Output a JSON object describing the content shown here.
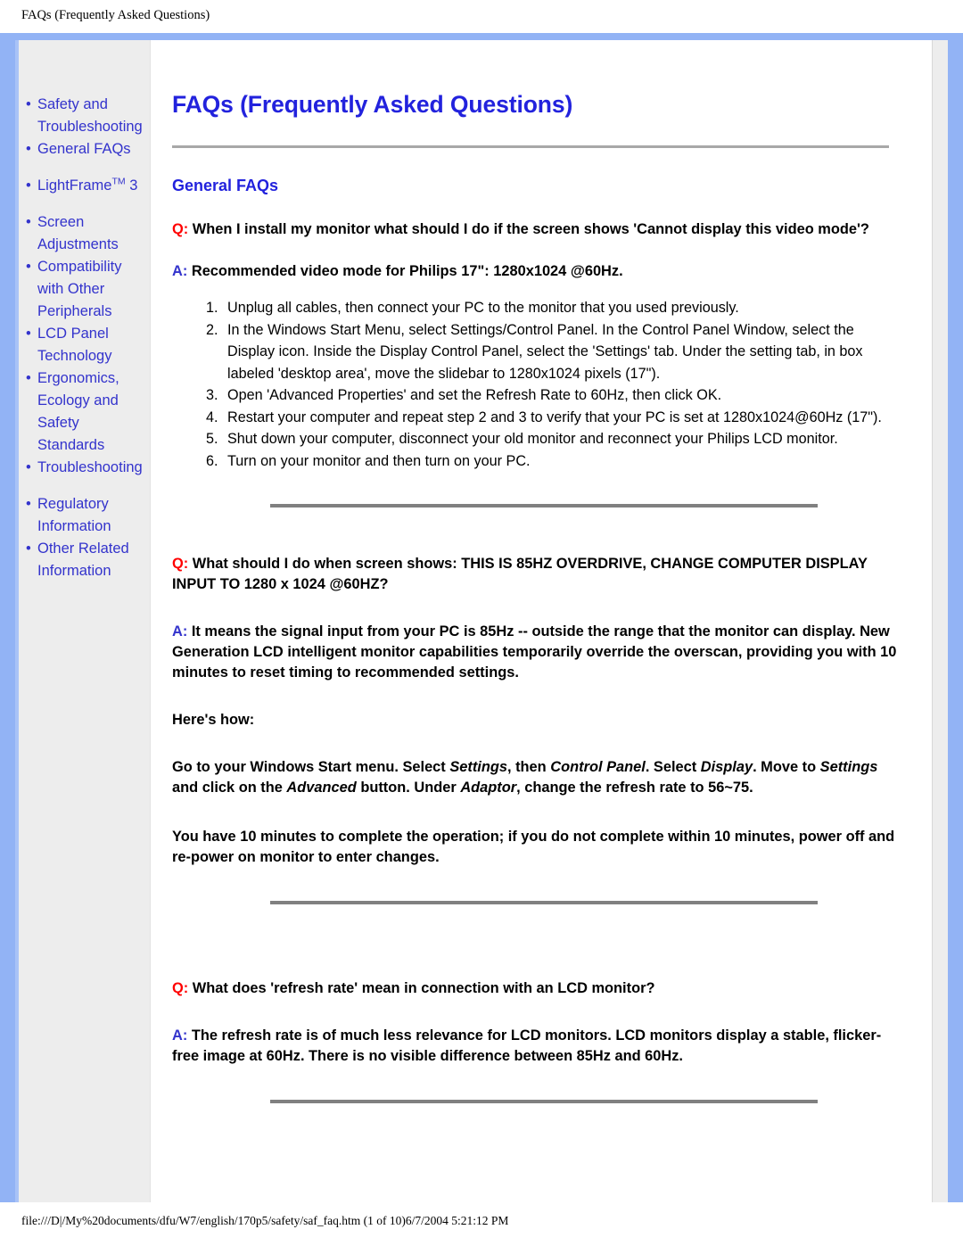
{
  "print_header": {
    "title": "FAQs (Frequently Asked Questions)"
  },
  "sidebar": {
    "items": [
      {
        "label": "Safety and Troubleshooting"
      },
      {
        "label": "General FAQs"
      },
      {
        "label_prefix": "LightFrame",
        "superscript": "TM",
        "label_suffix": " 3"
      },
      {
        "label": "Screen Adjustments"
      },
      {
        "label": "Compatibility with Other Peripherals"
      },
      {
        "label": "LCD Panel Technology"
      },
      {
        "label": "Ergonomics, Ecology and Safety Standards"
      },
      {
        "label": "Troubleshooting"
      },
      {
        "label": "Regulatory Information"
      },
      {
        "label": "Other Related Information"
      }
    ]
  },
  "main": {
    "page_title": "FAQs (Frequently Asked Questions)",
    "section_title": "General FAQs",
    "q_marker": "Q:",
    "a_marker": "A:",
    "qa": [
      {
        "question": "When I install my monitor what should I do if the screen shows 'Cannot display this video mode'?",
        "answer": "Recommended video mode for Philips 17\": 1280x1024 @60Hz.",
        "steps": [
          "Unplug all cables, then connect your PC to the monitor that you used previously.",
          "In the Windows Start Menu, select Settings/Control Panel. In the Control Panel Window, select the Display icon. Inside the Display Control Panel, select the 'Settings' tab. Under the setting tab, in box labeled 'desktop area', move the slidebar to 1280x1024 pixels (17\").",
          "Open 'Advanced Properties' and set the Refresh Rate to 60Hz, then click OK.",
          "Restart your computer and repeat step 2 and 3 to verify that your PC is set at 1280x1024@60Hz (17\").",
          "Shut down your computer, disconnect your old monitor and reconnect your Philips LCD monitor.",
          "Turn on your monitor and then turn on your PC."
        ]
      },
      {
        "question": "What should I do when screen shows: THIS IS 85HZ OVERDRIVE, CHANGE COMPUTER DISPLAY INPUT TO 1280 x 1024 @60HZ?",
        "answer": "It means the signal input from your PC is 85Hz -- outside the range that the monitor can display. New Generation LCD intelligent monitor capabilities temporarily override the overscan, providing you with 10 minutes to reset timing to recommended settings.",
        "heres_how_label": "Here's how:",
        "instruction_parts": [
          {
            "text": "Go to your Windows Start menu. Select ",
            "italic": false
          },
          {
            "text": "Settings",
            "italic": true
          },
          {
            "text": ", then ",
            "italic": false
          },
          {
            "text": "Control Panel",
            "italic": true
          },
          {
            "text": ". Select ",
            "italic": false
          },
          {
            "text": "Display",
            "italic": true
          },
          {
            "text": ". Move to ",
            "italic": false
          },
          {
            "text": "Settings",
            "italic": true
          },
          {
            "text": " and click on the ",
            "italic": false
          },
          {
            "text": "Advanced",
            "italic": true
          },
          {
            "text": " button. Under ",
            "italic": false
          },
          {
            "text": "Adaptor",
            "italic": true
          },
          {
            "text": ", change the refresh rate to 56~75.",
            "italic": false
          }
        ],
        "note": "You have 10 minutes to complete the operation; if you do not complete within 10 minutes, power off and re-power on monitor to enter changes."
      },
      {
        "question": "What does 'refresh rate' mean in connection with an LCD monitor?",
        "answer": "The refresh rate is of much less relevance for LCD monitors. LCD monitors display a stable, flicker-free image at 60Hz. There is no visible difference between 85Hz and 60Hz."
      }
    ]
  },
  "print_footer": {
    "path": "file:///D|/My%20documents/dfu/W7/english/170p5/safety/saf_faq.htm (1 of 10)6/7/2004 5:21:12 PM"
  },
  "colors": {
    "frame_blue": "#92b3f5",
    "link_blue": "#3333cc",
    "title_blue": "#2222dd",
    "q_red": "#ff0000",
    "sidebar_gray": "#ededed",
    "rule_gray": "#808080"
  }
}
